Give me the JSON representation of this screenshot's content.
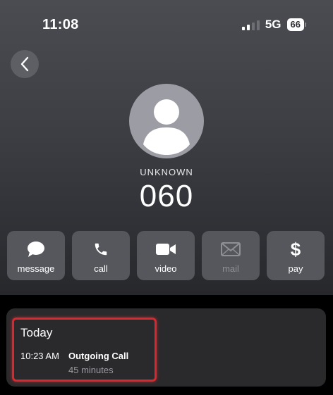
{
  "status": {
    "time": "11:08",
    "network": "5G",
    "battery": "66",
    "signal_bars": 4,
    "signal_bars_active": 2
  },
  "contact": {
    "label": "UNKNOWN",
    "number": "060"
  },
  "actions": [
    {
      "label": "message",
      "icon": "message-bubble-icon",
      "enabled": true
    },
    {
      "label": "call",
      "icon": "phone-icon",
      "enabled": true
    },
    {
      "label": "video",
      "icon": "video-camera-icon",
      "enabled": true
    },
    {
      "label": "mail",
      "icon": "envelope-icon",
      "enabled": false
    },
    {
      "label": "pay",
      "icon": "dollar-icon",
      "enabled": true
    }
  ],
  "history": {
    "title": "Today",
    "entries": [
      {
        "time": "10:23 AM",
        "type": "Outgoing Call",
        "duration": "45 minutes"
      }
    ]
  },
  "colors": {
    "highlight": "#d42a30",
    "card": "#2a2a2c",
    "action_bg": "#55575d"
  }
}
